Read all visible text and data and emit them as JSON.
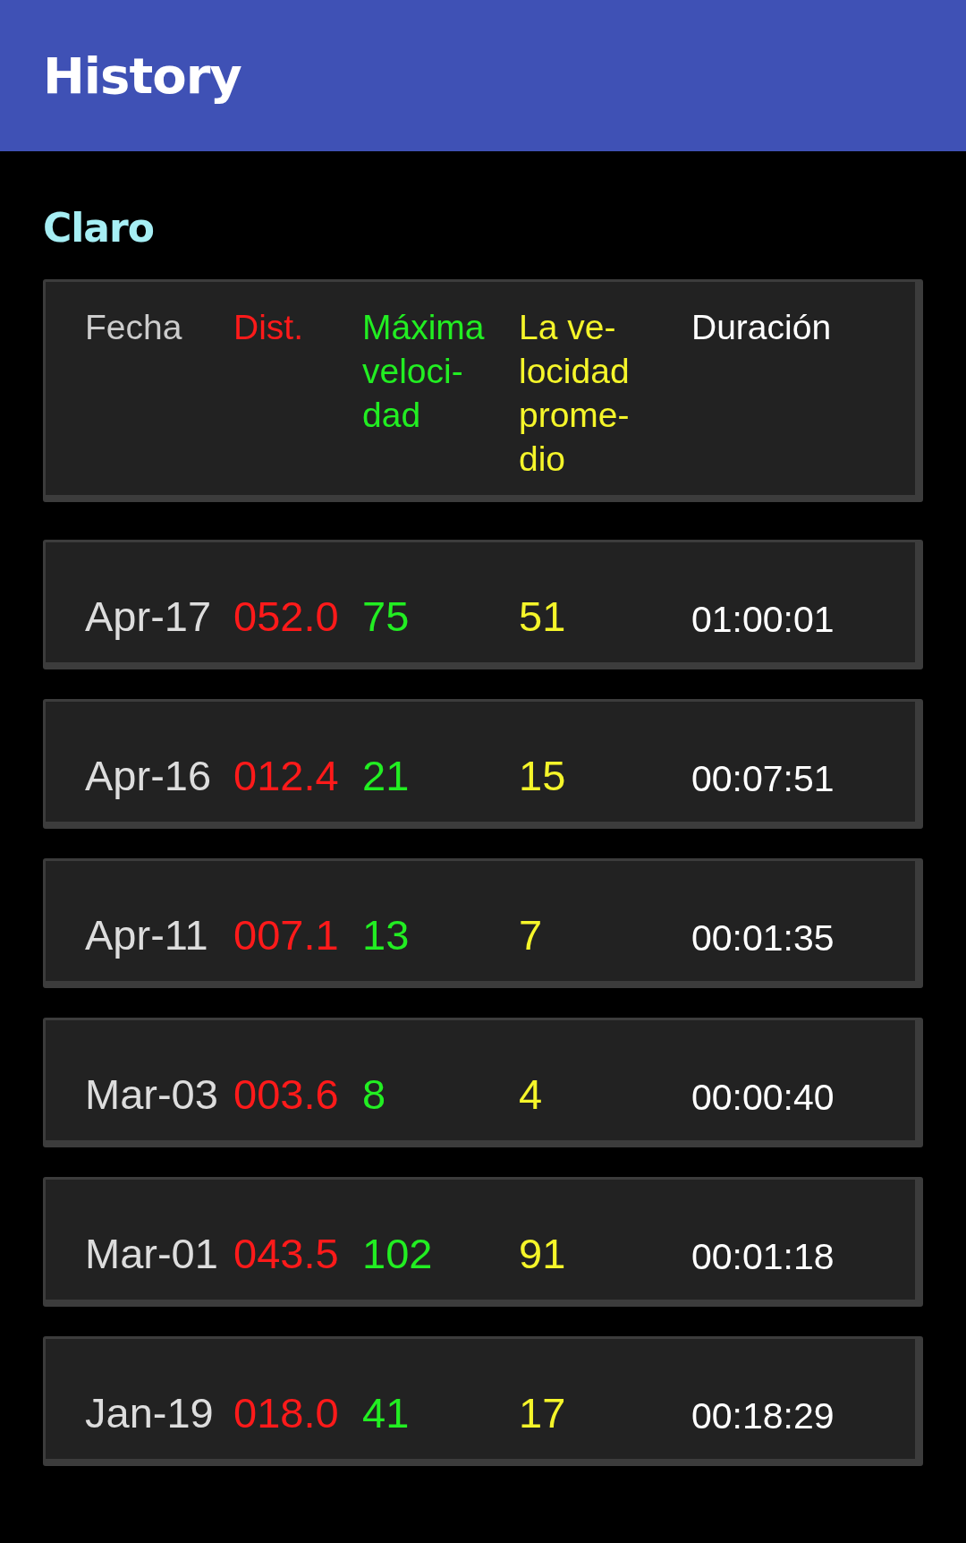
{
  "app_bar": {
    "title": "History"
  },
  "section": {
    "title": "Claro"
  },
  "columns": [
    {
      "lines": [
        "Fecha"
      ],
      "color": "#cccccc"
    },
    {
      "lines": [
        "Dist."
      ],
      "color": "#ff1a1a"
    },
    {
      "lines": [
        "Máxima",
        "veloci-",
        "dad"
      ],
      "color": "#22ee22"
    },
    {
      "lines": [
        "La ve-",
        "locidad",
        "prome-",
        "dio"
      ],
      "color": "#f5f52a"
    },
    {
      "lines": [
        "Duración"
      ],
      "color": "#ffffff"
    }
  ],
  "rows": [
    {
      "cells": [
        "Apr-17",
        "052.0",
        "75",
        "51",
        "01:00:01"
      ]
    },
    {
      "cells": [
        "Apr-16",
        "012.4",
        "21",
        "15",
        "00:07:51"
      ]
    },
    {
      "cells": [
        "Apr-11",
        "007.1",
        "13",
        "7",
        "00:01:35"
      ]
    },
    {
      "cells": [
        "Mar-03",
        "003.6",
        "8",
        "4",
        "00:00:40"
      ]
    },
    {
      "cells": [
        "Mar-01",
        "043.5",
        "102",
        "91",
        "00:01:18"
      ]
    },
    {
      "cells": [
        "Jan-19",
        "018.0",
        "41",
        "17",
        "00:18:29"
      ]
    }
  ]
}
